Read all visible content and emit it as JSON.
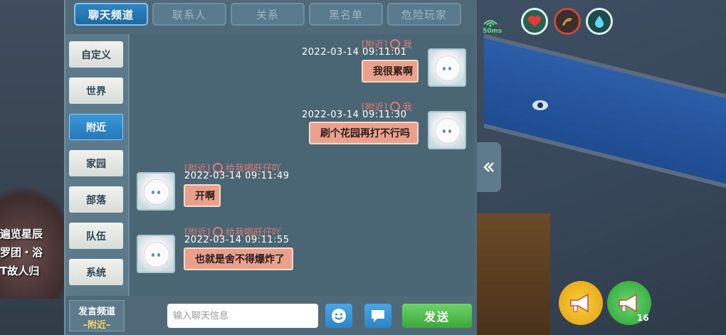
{
  "tabs": [
    "聊天频道",
    "联系人",
    "关系",
    "黑名单",
    "危险玩家"
  ],
  "active_tab": 0,
  "sidebar": [
    "自定义",
    "世界",
    "附近",
    "家园",
    "部落",
    "队伍",
    "系统"
  ],
  "active_sidebar": 2,
  "messages": [
    {
      "channel": "[附近]",
      "name": "我",
      "time": "2022-03-14  09:11:01",
      "text": "我很累啊",
      "side": "right"
    },
    {
      "channel": "[附近]",
      "name": "我",
      "time": "2022-03-14  09:11:30",
      "text": "刷个花园再打不行吗",
      "side": "right"
    },
    {
      "channel": "[附近]",
      "name": "给我喝旺仔吖",
      "time": "2022-03-14  09:11:49",
      "text": "开啊",
      "side": "left"
    },
    {
      "channel": "[附近]",
      "name": "给我喝旺仔吖",
      "time": "2022-03-14  09:11:55",
      "text": "也就是舍不得爆炸了",
      "side": "left"
    }
  ],
  "bottom": {
    "channel_label": "发言频道",
    "channel_value": "–附近–",
    "input_placeholder": "输入聊天信息",
    "send_label": "发送"
  },
  "hud": {
    "ping": "50ms",
    "speaker_count": "16"
  },
  "world_text": [
    "遍览星辰",
    "罗团・浴",
    "T故人归"
  ],
  "colors": {
    "tab_active": "#2d86c5",
    "bubble": "#e9a08d",
    "channel_text": "#e07a72",
    "send_button": "#3aa83a"
  }
}
